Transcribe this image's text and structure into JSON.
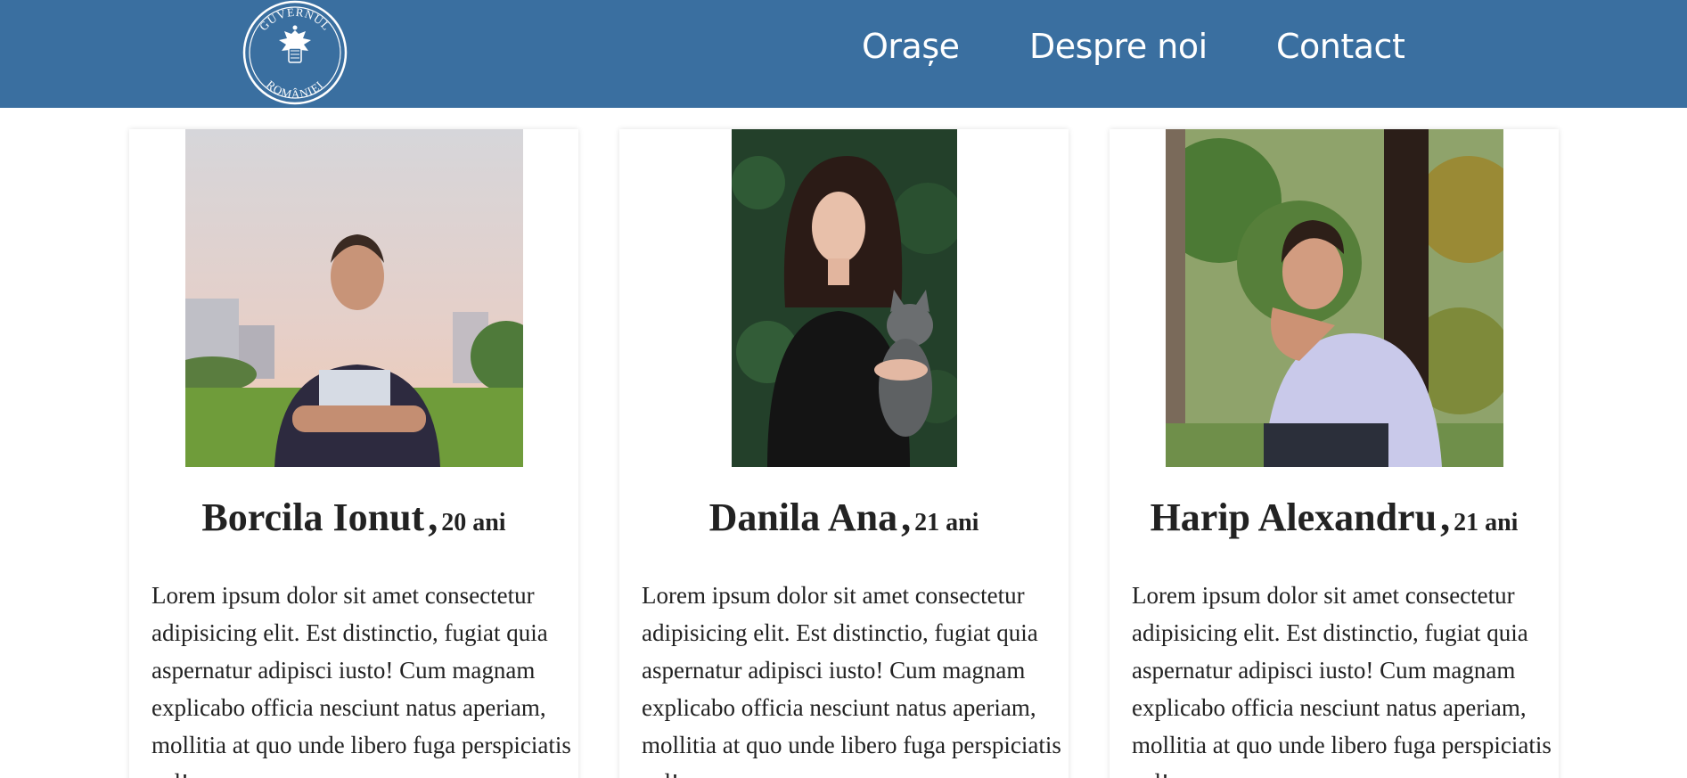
{
  "header": {
    "logo_text_top": "GUVERNUL",
    "logo_text_bottom": "ROMÂNIEI",
    "nav": [
      {
        "label": "Orașe"
      },
      {
        "label": "Despre noi"
      },
      {
        "label": "Contact"
      }
    ],
    "colors": {
      "navbar": "#3a6fa0",
      "text": "#ffffff"
    }
  },
  "people": [
    {
      "name": "Borcila Ionut",
      "separator": ",",
      "age": "20 ani",
      "description": "Lorem ipsum dolor sit amet consectetur adipisicing elit. Est distinctio, fugiat quia aspernatur adipisci iusto! Cum magnam explicabo officia nesciunt natus aperiam, mollitia at quo unde libero fuga perspiciatis vel!"
    },
    {
      "name": "Danila Ana",
      "separator": ",",
      "age": "21 ani",
      "description": "Lorem ipsum dolor sit amet consectetur adipisicing elit. Est distinctio, fugiat quia aspernatur adipisci iusto! Cum magnam explicabo officia nesciunt natus aperiam, mollitia at quo unde libero fuga perspiciatis vel!"
    },
    {
      "name": "Harip Alexandru",
      "separator": ",",
      "age": "21 ani",
      "description": "Lorem ipsum dolor sit amet consectetur adipisicing elit. Est distinctio, fugiat quia aspernatur adipisci iusto! Cum magnam explicabo officia nesciunt natus aperiam, mollitia at quo unde libero fuga perspiciatis vel!"
    }
  ]
}
